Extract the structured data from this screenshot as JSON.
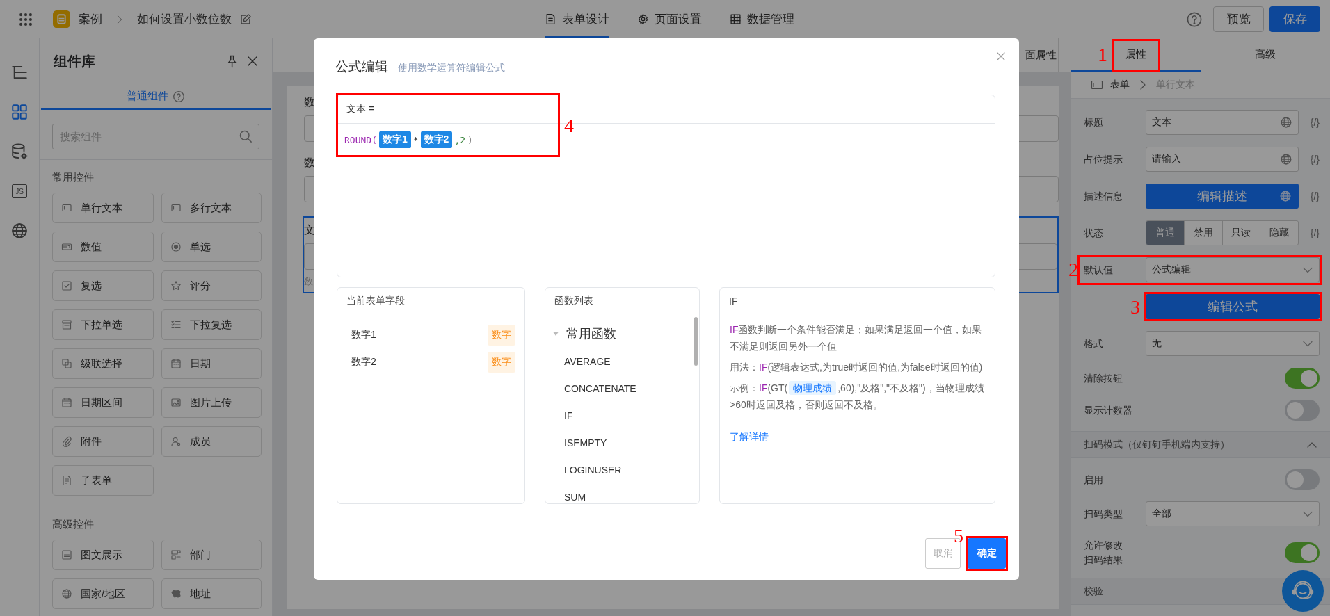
{
  "top_bar": {
    "app": "案例",
    "title": "如何设置小数位数",
    "tabs": [
      {
        "label": "表单设计",
        "kind": "document",
        "selected": true
      },
      {
        "label": "页面设置",
        "kind": "gear",
        "selected": false
      },
      {
        "label": "数据管理",
        "kind": "table",
        "selected": false
      }
    ],
    "buttons": [
      {
        "label": "预览",
        "kind": "secondary"
      },
      {
        "label": "保存",
        "kind": "primary"
      }
    ]
  },
  "rail": [
    {
      "kind": "outline",
      "selected": false
    },
    {
      "kind": "grid",
      "selected": true
    },
    {
      "kind": "database",
      "selected": false
    },
    {
      "kind": "script",
      "text": "JS",
      "selected": false
    },
    {
      "kind": "globe",
      "selected": false
    }
  ],
  "component_panel": {
    "title": "组件库",
    "tabs": [
      {
        "label": "普通组件",
        "selected": true
      }
    ],
    "search": {
      "placeholder": "搜索组件"
    },
    "groups": [
      {
        "title": "常用控件",
        "items": [
          {
            "label": "单行文本",
            "kind": "input"
          },
          {
            "label": "多行文本",
            "kind": "input"
          },
          {
            "label": "数值",
            "kind": "number"
          },
          {
            "label": "单选",
            "kind": "radio"
          },
          {
            "label": "复选",
            "kind": "checkbox"
          },
          {
            "label": "评分",
            "kind": "star"
          },
          {
            "label": "下拉单选",
            "kind": "select"
          },
          {
            "label": "下拉复选",
            "kind": "checklist"
          },
          {
            "label": "级联选择",
            "kind": "cascade"
          },
          {
            "label": "日期",
            "kind": "calendar"
          },
          {
            "label": "日期区间",
            "kind": "calendar"
          },
          {
            "label": "图片上传",
            "kind": "image"
          },
          {
            "label": "附件",
            "kind": "clip"
          },
          {
            "label": "成员",
            "kind": "user"
          },
          {
            "label": "子表单",
            "kind": "doc"
          }
        ]
      },
      {
        "title": "高级控件",
        "items": [
          {
            "label": "图文展示",
            "kind": "lines"
          },
          {
            "label": "部门",
            "kind": "org"
          },
          {
            "label": "国家/地区",
            "kind": "globe"
          },
          {
            "label": "地址",
            "kind": "map"
          }
        ]
      }
    ]
  },
  "canvas": {
    "tab": "面属性",
    "fields": [
      {
        "label": "数",
        "selected": false
      },
      {
        "label": "数",
        "selected": false
      },
      {
        "label": "文",
        "selected": true,
        "hint": "数"
      }
    ]
  },
  "properties": {
    "tabs": [
      {
        "label": "属性",
        "selected": true,
        "callout": "1"
      },
      {
        "label": "高级",
        "selected": false
      }
    ],
    "breadcrumb": [
      "表单",
      "单行文本"
    ],
    "rows": [
      {
        "kind": "text",
        "label": "标题",
        "value": "文本",
        "translatable": true,
        "expr": "{/}"
      },
      {
        "kind": "text",
        "label": "占位提示",
        "value": "请输入",
        "translatable": true,
        "expr": "{/}"
      },
      {
        "kind": "button",
        "label": "描述信息",
        "value": "编辑描述",
        "translatable": true,
        "expr": "{/}"
      },
      {
        "kind": "segmented",
        "label": "状态",
        "options": [
          {
            "label": "普通",
            "selected": true
          },
          {
            "label": "禁用",
            "selected": false
          },
          {
            "label": "只读",
            "selected": false
          },
          {
            "label": "隐藏",
            "selected": false
          }
        ],
        "expr": "{/}"
      },
      {
        "kind": "select",
        "label": "默认值",
        "value": "公式编辑",
        "callout": "2"
      },
      {
        "kind": "action",
        "value": "编辑公式",
        "callout": "3"
      },
      {
        "kind": "select",
        "label": "格式",
        "value": "无"
      },
      {
        "kind": "toggle",
        "label": "清除按钮",
        "on": true
      },
      {
        "kind": "toggle",
        "label": "显示计数器",
        "on": false
      },
      {
        "kind": "section",
        "label": "扫码模式（仅钉钉手机端内支持）",
        "expanded": true
      },
      {
        "kind": "toggle",
        "label": "启用",
        "on": false
      },
      {
        "kind": "select",
        "label": "扫码类型",
        "value": "全部"
      },
      {
        "kind": "toggle",
        "label_lines": [
          "允许修改",
          "扫码结果"
        ],
        "on": true
      },
      {
        "kind": "section",
        "label": "校验"
      }
    ]
  },
  "dialog": {
    "title": "公式编辑",
    "subtitle": "使用数学运算符编辑公式",
    "target": "文本 =",
    "callout": "4",
    "formula": [
      {
        "kind": "func",
        "text": "ROUND("
      },
      {
        "kind": "field",
        "text": "数字1"
      },
      {
        "kind": "op",
        "text": "*"
      },
      {
        "kind": "field",
        "text": "数字2"
      },
      {
        "kind": "num",
        "text": ",2"
      },
      {
        "kind": "paren",
        "text": ")"
      }
    ],
    "fields_panel": {
      "title": "当前表单字段",
      "items": [
        {
          "name": "数字1",
          "type": "数字"
        },
        {
          "name": "数字2",
          "type": "数字"
        }
      ]
    },
    "functions_panel": {
      "title": "函数列表",
      "groups": [
        {
          "name": "常用函数",
          "expanded": true,
          "children": [
            {
              "name": "AVERAGE"
            },
            {
              "name": "CONCATENATE"
            },
            {
              "name": "IF"
            },
            {
              "name": "ISEMPTY"
            },
            {
              "name": "LOGINUSER"
            },
            {
              "name": "SUM"
            }
          ]
        }
      ]
    },
    "help_panel": {
      "title": "IF",
      "paragraphs": [
        [
          {
            "kind": "func",
            "text": "IF"
          },
          {
            "kind": "text",
            "text": "函数判断一个条件能否满足；如果满足返回一个值，如果不满足则返回另外一个值"
          }
        ],
        [
          {
            "kind": "text",
            "text": "用法："
          },
          {
            "kind": "func",
            "text": "IF"
          },
          {
            "kind": "text",
            "text": "(逻辑表达式,为true时返回的值,为false时返回的值)"
          }
        ],
        [
          {
            "kind": "text",
            "text": "示例："
          },
          {
            "kind": "func",
            "text": "IF"
          },
          {
            "kind": "text",
            "text": "(GT("
          },
          {
            "kind": "field",
            "text": "物理成绩"
          },
          {
            "kind": "text",
            "text": ",60),\"及格\",\"不及格\")，当物理成绩>60时返回及格，否则返回不及格。"
          }
        ]
      ],
      "link": "了解详情"
    },
    "buttons": [
      {
        "label": "取消",
        "kind": "secondary"
      },
      {
        "label": "确定",
        "kind": "primary",
        "callout": "5"
      }
    ]
  }
}
